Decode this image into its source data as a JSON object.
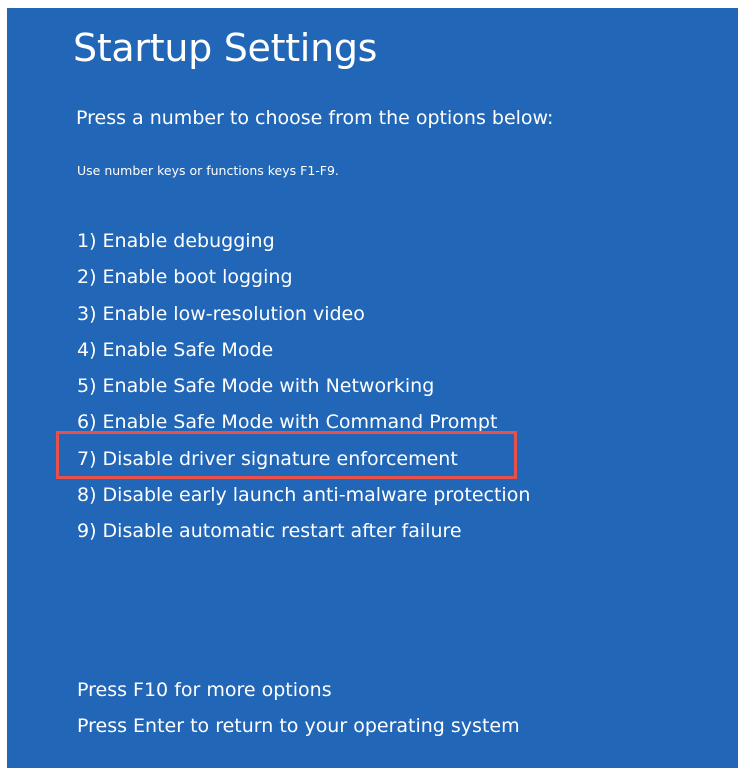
{
  "title": "Startup Settings",
  "prompt": "Press a number to choose from the options below:",
  "hint": "Use number keys or functions keys F1-F9.",
  "options": [
    {
      "label": "1) Enable debugging"
    },
    {
      "label": "2) Enable boot logging"
    },
    {
      "label": "3) Enable low-resolution video"
    },
    {
      "label": "4) Enable Safe Mode"
    },
    {
      "label": "5) Enable Safe Mode with Networking"
    },
    {
      "label": "6) Enable Safe Mode with Command Prompt"
    },
    {
      "label": "7) Disable driver signature enforcement"
    },
    {
      "label": "8) Disable early launch anti-malware protection"
    },
    {
      "label": "9) Disable automatic restart after failure"
    }
  ],
  "highlighted_option": 7,
  "footer": {
    "more_options": "Press F10 for more options",
    "return": "Press Enter to return to your operating system"
  },
  "colors": {
    "background": "#2166b7",
    "text": "#ffffff",
    "highlight": "#e8514a"
  }
}
